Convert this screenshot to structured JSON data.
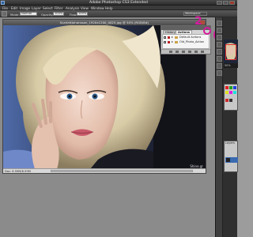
{
  "window": {
    "title": "Adobe Photoshop CS3 Extended"
  },
  "menu": [
    "File",
    "Edit",
    "Image",
    "Layer",
    "Select",
    "Filter",
    "Analysis",
    "View",
    "Window",
    "Help"
  ],
  "options": {
    "mode_label": "Mode:",
    "mode_value": "Normal",
    "opacity_label": "Opacity:",
    "opacity_value": "100%",
    "flow_label": "Flow:",
    "flow_value": "100%",
    "workspace_label": "Workspace"
  },
  "document": {
    "title": "ScarlettJohansson_1920x1200_0025.jpg @ 50% (RGB/8#)",
    "zoom": "50%",
    "status": "Doc: 6.59M/6.59M",
    "watermark": "Shine.gr"
  },
  "actions_panel": {
    "tabs": [
      "History",
      "Actions"
    ],
    "rows": [
      {
        "label": "Default Actions"
      },
      {
        "label": "Old_Photo_Action"
      }
    ]
  },
  "annotations": {
    "step1": "1",
    "step2": "2"
  },
  "right_dock": {
    "zoom": "50%",
    "layers_tab": "Layers"
  },
  "colors": {
    "annotation": "#d31b9c",
    "ps_blue": "#2f5f98"
  }
}
